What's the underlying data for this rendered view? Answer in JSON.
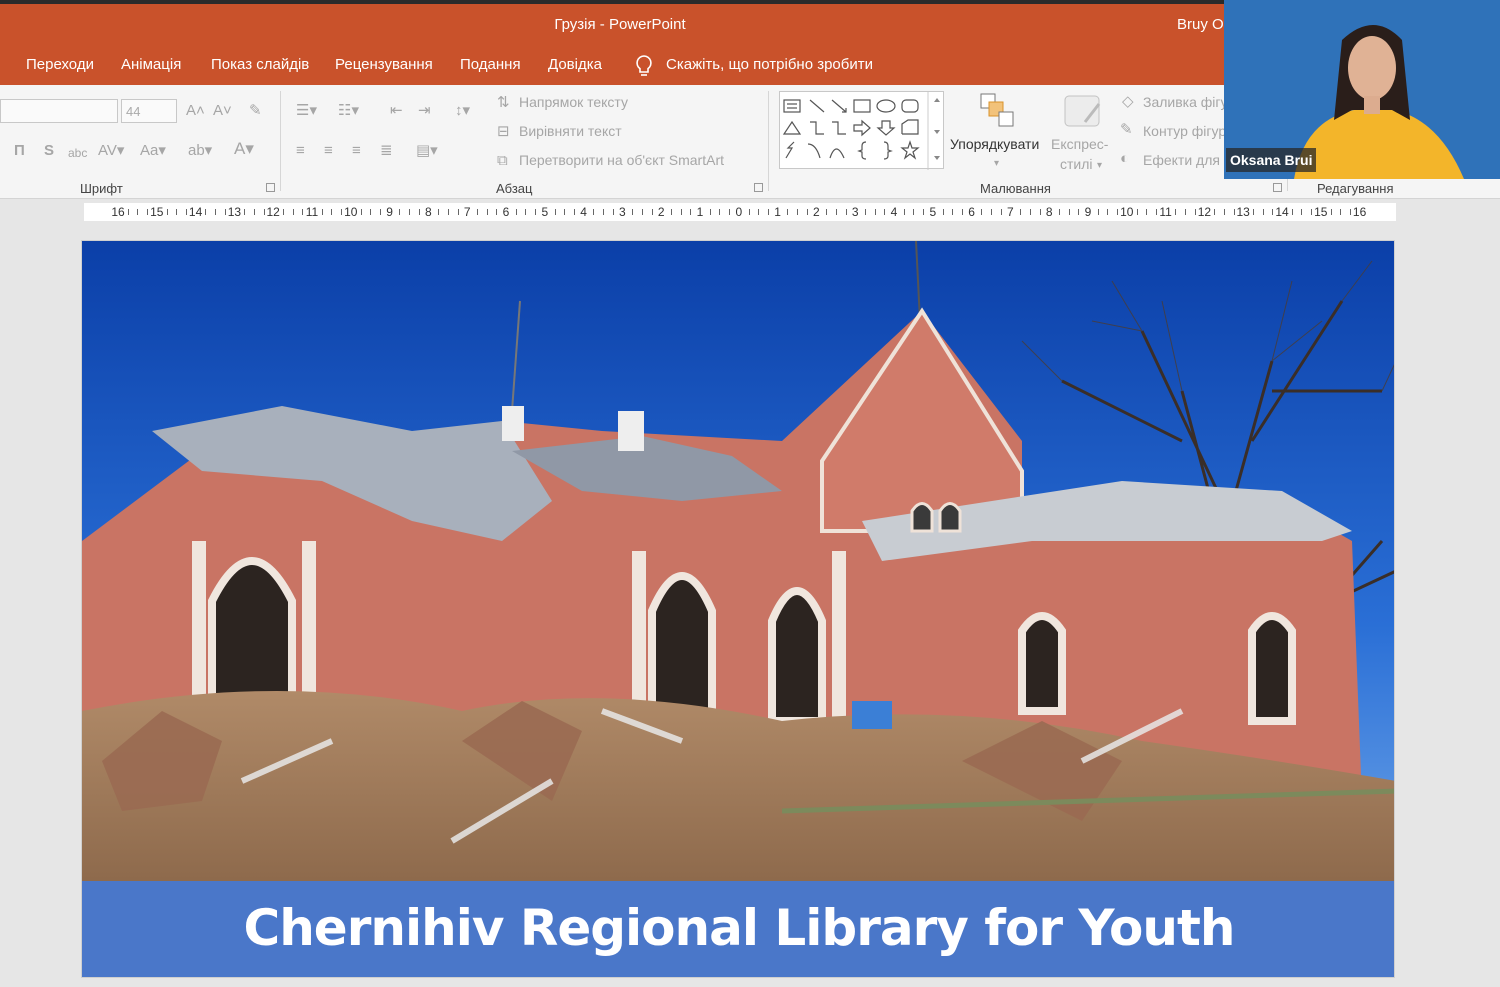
{
  "window": {
    "title": "Грузія  -  PowerPoint",
    "user": "Bruy Ol"
  },
  "tabs": [
    {
      "label": "Переходи"
    },
    {
      "label": "Анімація"
    },
    {
      "label": "Показ слайдів"
    },
    {
      "label": "Рецензування"
    },
    {
      "label": "Подання"
    },
    {
      "label": "Довідка"
    }
  ],
  "tell_me": "Скажіть, що потрібно зробити",
  "ribbon": {
    "font": {
      "size": "44",
      "label": "Шрифт"
    },
    "paragraph": {
      "label": "Абзац",
      "text_direction": "Напрямок тексту",
      "align_text": "Вирівняти текст",
      "smartart": "Перетворити на об'єкт SmartArt"
    },
    "drawing": {
      "label": "Малювання",
      "arrange": "Упорядкувати",
      "quick_styles_1": "Експрес-",
      "quick_styles_2": "стилі",
      "shape_fill": "Заливка фігури",
      "shape_outline": "Контур фігури",
      "shape_effects": "Ефекти для фігур"
    },
    "editing": {
      "label": "Редагування"
    }
  },
  "ruler": {
    "labels": [
      "16",
      "15",
      "14",
      "13",
      "12",
      "11",
      "10",
      "9",
      "8",
      "7",
      "6",
      "5",
      "4",
      "3",
      "2",
      "1",
      "0",
      "1",
      "2",
      "3",
      "4",
      "5",
      "6",
      "7",
      "8",
      "9",
      "10",
      "11",
      "12",
      "13",
      "14",
      "15",
      "16"
    ]
  },
  "slide": {
    "caption": "Chernihiv Regional Library for Youth"
  },
  "participant": {
    "name": "Oksana Brui"
  }
}
